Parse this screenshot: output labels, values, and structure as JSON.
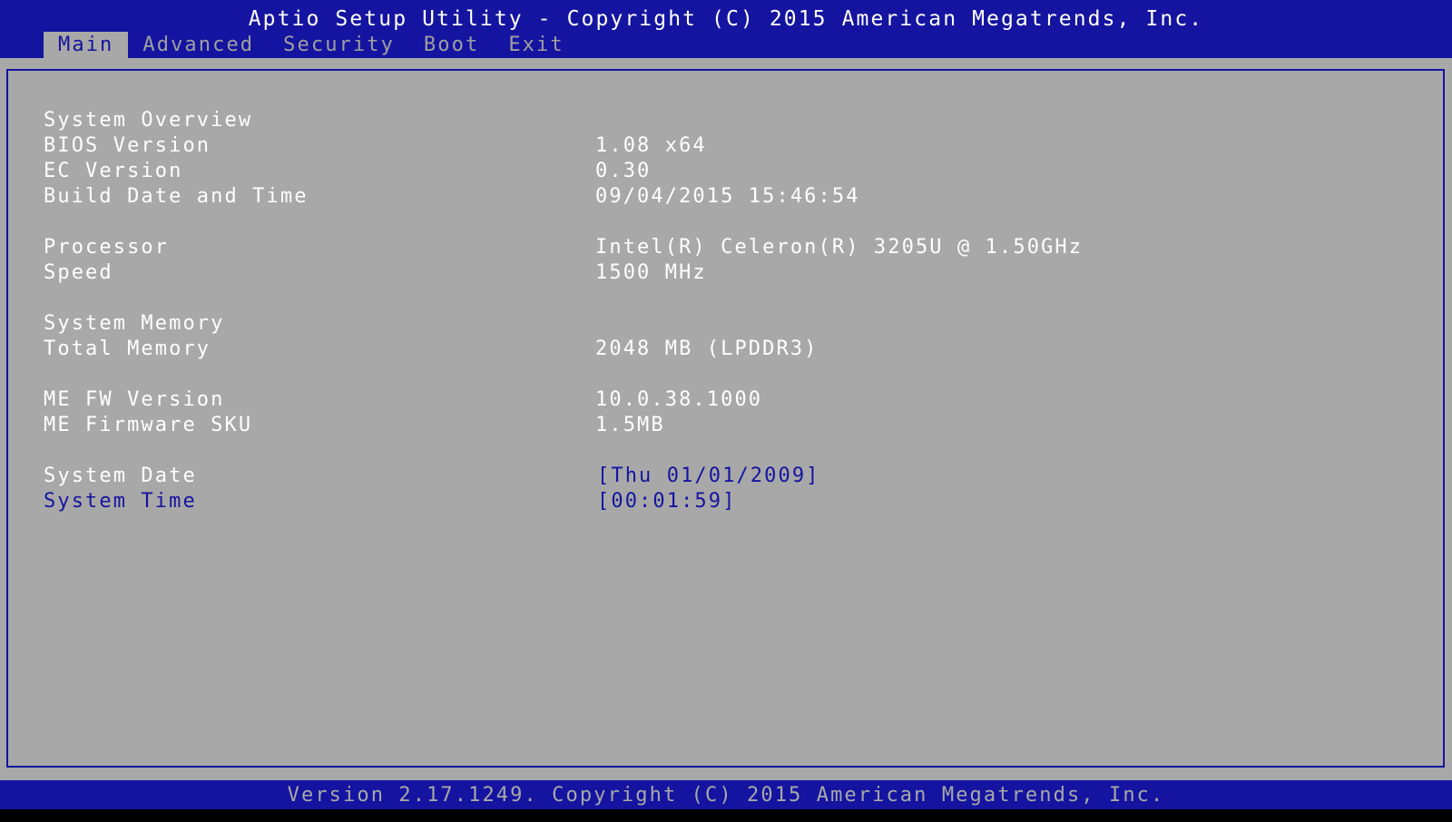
{
  "header": {
    "title": "Aptio Setup Utility - Copyright (C) 2015 American Megatrends, Inc."
  },
  "tabs": [
    {
      "label": "Main",
      "active": true
    },
    {
      "label": "Advanced",
      "active": false
    },
    {
      "label": "Security",
      "active": false
    },
    {
      "label": "Boot",
      "active": false
    },
    {
      "label": "Exit",
      "active": false
    }
  ],
  "main": {
    "system_overview": {
      "label": "System Overview"
    },
    "bios_version": {
      "label": "BIOS Version",
      "value": "1.08 x64"
    },
    "ec_version": {
      "label": "EC Version",
      "value": "0.30"
    },
    "build_date": {
      "label": "Build Date and Time",
      "value": "09/04/2015 15:46:54"
    },
    "processor": {
      "label": "Processor",
      "value": "Intel(R) Celeron(R) 3205U @ 1.50GHz"
    },
    "speed": {
      "label": "Speed",
      "value": "1500 MHz"
    },
    "system_memory": {
      "label": "System Memory"
    },
    "total_memory": {
      "label": "Total Memory",
      "value": "2048 MB (LPDDR3)"
    },
    "me_fw_version": {
      "label": "ME FW Version",
      "value": "10.0.38.1000"
    },
    "me_firmware_sku": {
      "label": "ME Firmware SKU",
      "value": "1.5MB"
    },
    "system_date": {
      "label": "System Date",
      "value": "[Thu 01/01/2009]"
    },
    "system_time": {
      "label": "System Time",
      "value": "[00:01:59]"
    }
  },
  "footer": {
    "version": "Version 2.17.1249. Copyright (C) 2015 American Megatrends, Inc."
  },
  "colors": {
    "bios_blue": "#1414a0",
    "panel_gray": "#a8a8a8",
    "text_white": "#ffffff"
  }
}
